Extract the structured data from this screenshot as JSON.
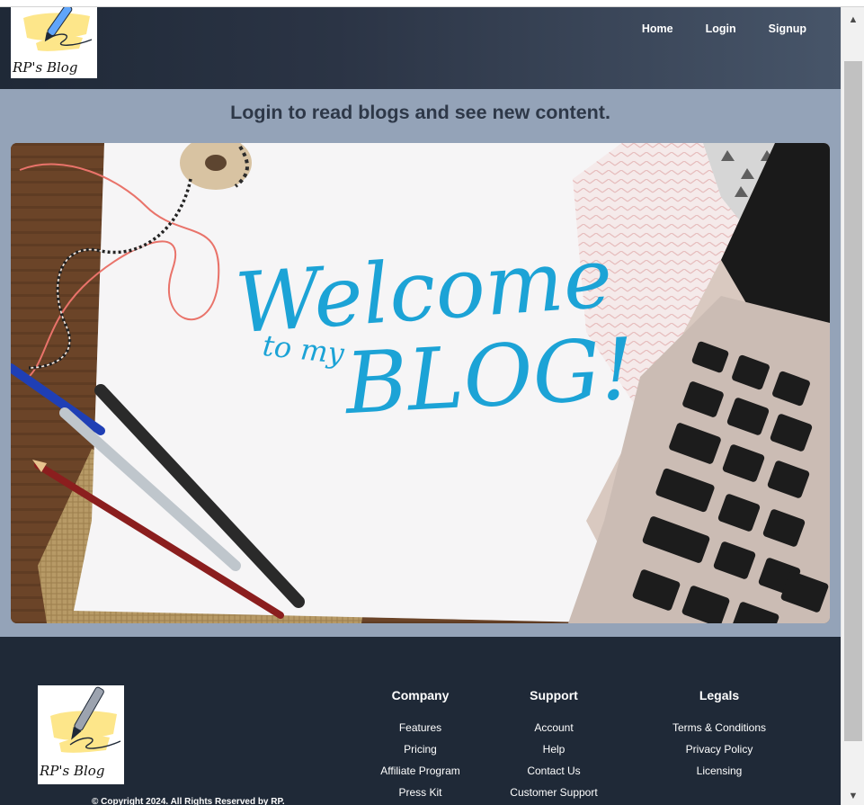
{
  "nav": {
    "logo_text": "RP's Blog",
    "links": [
      "Home",
      "Login",
      "Signup"
    ]
  },
  "headline": "Login to read blogs and see new content.",
  "hero": {
    "line1": "Welcome",
    "line2a": "to my",
    "line2b": "BLOG!"
  },
  "footer": {
    "logo_text": "RP's Blog",
    "copyright": "© Copyright 2024. All Rights Reserved by RP.",
    "columns": [
      {
        "title": "Company",
        "items": [
          "Features",
          "Pricing",
          "Affiliate Program",
          "Press Kit"
        ]
      },
      {
        "title": "Support",
        "items": [
          "Account",
          "Help",
          "Contact Us",
          "Customer Support"
        ]
      },
      {
        "title": "Legals",
        "items": [
          "Terms & Conditions",
          "Privacy Policy",
          "Licensing"
        ]
      }
    ]
  },
  "colors": {
    "page_bg": "#94a3b8",
    "navbar_dark": "#1f2937",
    "footer_bg": "#1f2937",
    "headline": "#2e3848",
    "hero_text": "#1ca3d6"
  },
  "icons": {
    "logo": "pen-scribble-logo",
    "scroll_up": "triangle-up-icon",
    "scroll_down": "triangle-down-icon"
  }
}
